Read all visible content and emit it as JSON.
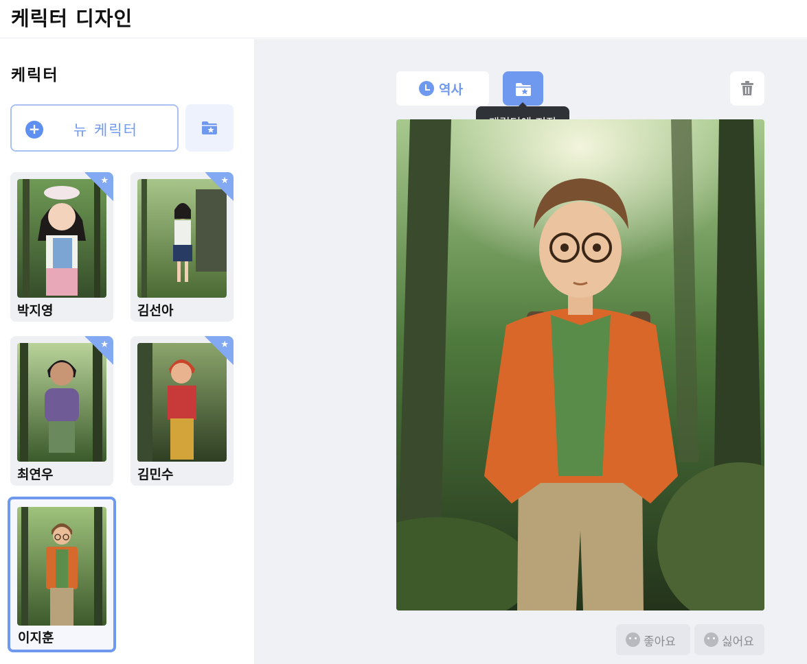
{
  "app": {
    "title": "케릭터 디자인"
  },
  "sidebar": {
    "title": "케릭터",
    "new_button_label": "뉴 케릭터",
    "characters": [
      {
        "name": "박지영",
        "starred": true,
        "selected": false
      },
      {
        "name": "김선아",
        "starred": true,
        "selected": false
      },
      {
        "name": "최연우",
        "starred": true,
        "selected": false
      },
      {
        "name": "김민수",
        "starred": true,
        "selected": false
      },
      {
        "name": "이지훈",
        "starred": false,
        "selected": true
      }
    ]
  },
  "toolbar": {
    "history_label": "역사",
    "save_tooltip": "케릭터에 저장"
  },
  "feedback": {
    "like_label": "좋아요",
    "dislike_label": "싫어요"
  },
  "colors": {
    "accent": "#6f99ee",
    "accent_light": "#edf2fd",
    "main_bg": "#f0f1f5",
    "tooltip_bg": "#2f3236"
  },
  "icons": {
    "new": "plus-circle-icon",
    "folder": "folder-star-icon",
    "history": "clock-icon",
    "delete": "trash-icon",
    "like": "smile-face-icon",
    "dislike": "sad-face-icon",
    "star": "star-icon",
    "collapse": "chevron-left-icon"
  }
}
